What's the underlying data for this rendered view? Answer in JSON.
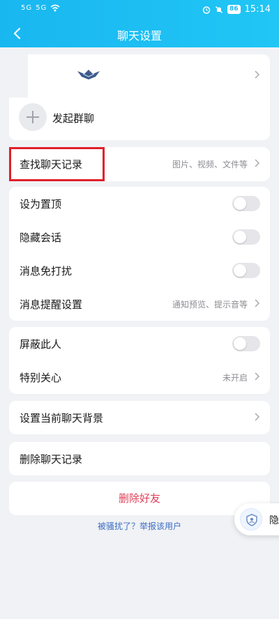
{
  "status_bar": {
    "sim1": "5G",
    "sim2": "5G",
    "battery": "86",
    "time": "15:14"
  },
  "header": {
    "title": "聊天设置"
  },
  "profile": {
    "create_group_label": "发起群聊"
  },
  "search_history": {
    "label": "查找聊天记录",
    "hint": "图片、视频、文件等"
  },
  "settings_group1": [
    {
      "label": "设为置顶",
      "toggle_on": false
    },
    {
      "label": "隐藏会话",
      "toggle_on": false
    },
    {
      "label": "消息免打扰",
      "toggle_on": false
    }
  ],
  "reminder": {
    "label": "消息提醒设置",
    "hint": "通知预览、提示音等"
  },
  "settings_group2": {
    "block": {
      "label": "屏蔽此人",
      "toggle_on": false
    },
    "special_care": {
      "label": "特别关心",
      "hint": "未开启"
    }
  },
  "background": {
    "label": "设置当前聊天背景"
  },
  "delete_history": {
    "label": "删除聊天记录"
  },
  "delete_friend": {
    "label": "删除好友",
    "color": "#e0405a"
  },
  "report": {
    "text": "被骚扰了？举报该用户",
    "color": "#3b6cc4"
  },
  "floating_button": {
    "label": "隐"
  },
  "colors": {
    "header_bg": "#1ab8f0",
    "page_bg": "#f0f2f5",
    "highlight_border": "#e0202a"
  }
}
